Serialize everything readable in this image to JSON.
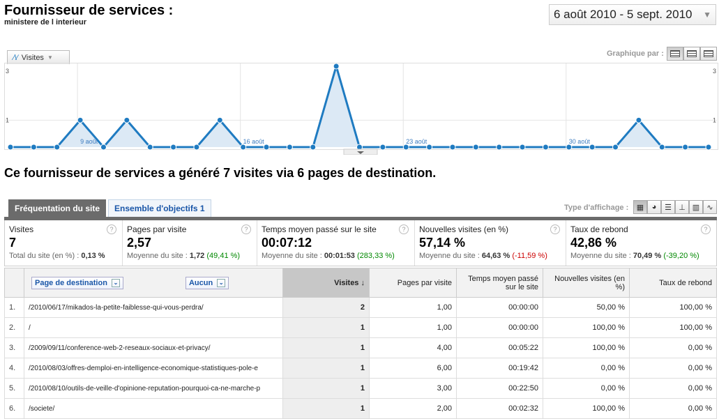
{
  "header": {
    "title": "Fournisseur de services :",
    "subtitle": "ministere de l interieur",
    "date_range": "6 août 2010 - 5 sept. 2010"
  },
  "chart_controls": {
    "metric_label": "Visites",
    "graph_by_label": "Graphique par :"
  },
  "chart_data": {
    "type": "line",
    "series": [
      {
        "name": "Visites",
        "values": [
          0,
          0,
          0,
          1,
          0,
          1,
          0,
          0,
          0,
          1,
          0,
          0,
          0,
          0,
          3,
          0,
          0,
          0,
          0,
          0,
          0,
          0,
          0,
          0,
          0,
          0,
          0,
          1,
          0,
          0,
          0
        ]
      }
    ],
    "x_tick_labels": [
      "9 août",
      "16 août",
      "23 août",
      "30 août"
    ],
    "y_tick_labels": [
      "3",
      "1"
    ],
    "ylim": [
      0,
      3
    ],
    "color": "#1f7bc1",
    "fill": "#dce9f5"
  },
  "headline": "Ce fournisseur de services a généré 7 visites via 6 pages de destination.",
  "tabs": [
    {
      "label": "Fréquentation du site"
    },
    {
      "label": "Ensemble d'objectifs 1"
    }
  ],
  "display_type_label": "Type d'affichage :",
  "summary": [
    {
      "label": "Visites",
      "value": "7",
      "sub_prefix": "Total du site (en %) : ",
      "sub_value": "0,13 %",
      "delta": ""
    },
    {
      "label": "Pages par visite",
      "value": "2,57",
      "sub_prefix": "Moyenne du site : ",
      "sub_value": "1,72",
      "delta": "(49,41 %)"
    },
    {
      "label": "Temps moyen passé sur le site",
      "value": "00:07:12",
      "sub_prefix": "Moyenne du site : ",
      "sub_value": "00:01:53",
      "delta": "(283,33 %)"
    },
    {
      "label": "Nouvelles visites (en %)",
      "value": "57,14 %",
      "sub_prefix": "Moyenne du site : ",
      "sub_value": "64,63 %",
      "delta": "(-11,59 %)"
    },
    {
      "label": "Taux de rebond",
      "value": "42,86 %",
      "sub_prefix": "Moyenne du site : ",
      "sub_value": "70,49 %",
      "delta": "(-39,20 %)"
    }
  ],
  "table": {
    "dimension_label": "Page de destination",
    "secondary_label": "Aucun",
    "columns": [
      "Visites",
      "Pages par visite",
      "Temps moyen passé sur le site",
      "Nouvelles visites (en %)",
      "Taux de rebond"
    ],
    "rows": [
      {
        "num": "1.",
        "page": "/2010/06/17/mikados-la-petite-faiblesse-qui-vous-perdra/",
        "visits": "2",
        "ppv": "1,00",
        "time": "00:00:00",
        "new": "50,00 %",
        "bounce": "100,00 %"
      },
      {
        "num": "2.",
        "page": "/",
        "visits": "1",
        "ppv": "1,00",
        "time": "00:00:00",
        "new": "100,00 %",
        "bounce": "100,00 %"
      },
      {
        "num": "3.",
        "page": "/2009/09/11/conference-web-2-reseaux-sociaux-et-privacy/",
        "visits": "1",
        "ppv": "4,00",
        "time": "00:05:22",
        "new": "100,00 %",
        "bounce": "0,00 %"
      },
      {
        "num": "4.",
        "page": "/2010/08/03/offres-demploi-en-intelligence-economique-statistiques-pole-e",
        "visits": "1",
        "ppv": "6,00",
        "time": "00:19:42",
        "new": "0,00 %",
        "bounce": "0,00 %"
      },
      {
        "num": "5.",
        "page": "/2010/08/10/outils-de-veille-d'opinione-reputation-pourquoi-ca-ne-marche-p",
        "visits": "1",
        "ppv": "3,00",
        "time": "00:22:50",
        "new": "0,00 %",
        "bounce": "0,00 %"
      },
      {
        "num": "6.",
        "page": "/societe/",
        "visits": "1",
        "ppv": "2,00",
        "time": "00:02:32",
        "new": "100,00 %",
        "bounce": "0,00 %"
      }
    ]
  }
}
